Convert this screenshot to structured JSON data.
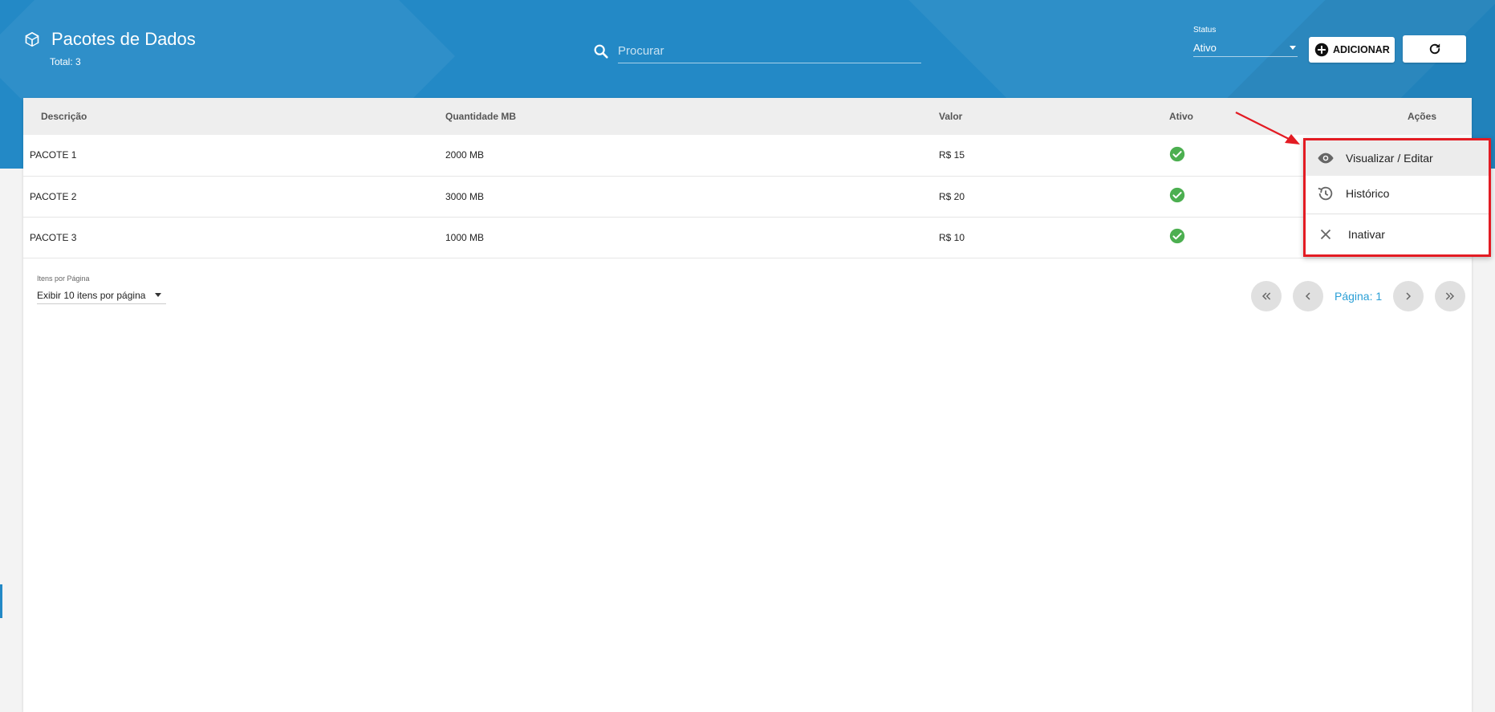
{
  "header": {
    "title": "Pacotes de Dados",
    "total": "Total: 3",
    "search_placeholder": "Procurar",
    "status_label": "Status",
    "status_value": "Ativo",
    "add_label": "ADICIONAR"
  },
  "table": {
    "columns": [
      "Descrição",
      "Quantidade MB",
      "Valor",
      "Ativo",
      "Ações"
    ],
    "rows": [
      {
        "descricao": "PACOTE 1",
        "quantidade": "2000 MB",
        "valor": "R$ 15",
        "ativo": true
      },
      {
        "descricao": "PACOTE 2",
        "quantidade": "3000 MB",
        "valor": "R$ 20",
        "ativo": true
      },
      {
        "descricao": "PACOTE 3",
        "quantidade": "1000 MB",
        "valor": "R$ 10",
        "ativo": true
      }
    ]
  },
  "pagination": {
    "items_label": "Itens por Página",
    "items_value": "Exibir 10 itens por página",
    "page_label": "Página: 1"
  },
  "menu": {
    "items": [
      {
        "label": "Visualizar / Editar",
        "icon": "eye-icon"
      },
      {
        "label": "Histórico",
        "icon": "history-icon"
      },
      {
        "label": "Inativar",
        "icon": "close-icon"
      }
    ]
  },
  "colors": {
    "header_bg": "#2389c6",
    "check_green": "#4caf50",
    "highlight_red": "#e31b23",
    "page_blue": "#2a9fd6"
  }
}
